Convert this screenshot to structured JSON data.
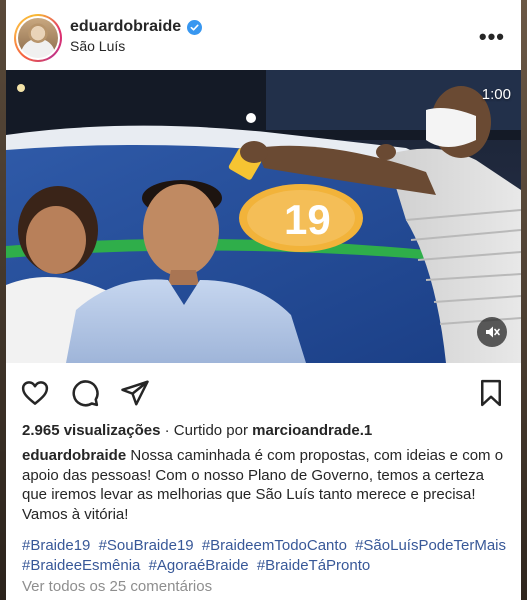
{
  "post": {
    "username": "eduardobraide",
    "location": "São Luís",
    "more_label": "•••",
    "video_time": "1:00",
    "overlay_number": "19",
    "views": "2.965 visualizações",
    "liked_by_prefix": "· Curtido por",
    "liked_by_user": "marcioandrade.1",
    "caption_author": "eduardobraide",
    "caption_text": "Nossa caminhada é com propostas, com ideias e com o apoio das pessoas! Com o nosso Plano de Governo, temos a certeza que iremos levar as melhorias que São Luís tanto merece e precisa! Vamos à vitória!",
    "hashtags": [
      "#Braide19",
      "#SouBraide19",
      "#BraideemTodoCanto",
      "#SãoLuísPodeTerMais",
      "#BraideeEsmênia",
      "#AgoraéBraide",
      "#BraideTáPronto"
    ],
    "comments_link": "Ver todos os 25 comentários"
  },
  "icons": {
    "verified": "verified-badge-icon",
    "like": "heart-icon",
    "comment": "comment-bubble-icon",
    "share": "paper-plane-icon",
    "save": "bookmark-icon",
    "mute": "speaker-muted-icon"
  },
  "colors": {
    "verified": "#3897f0",
    "hashtag": "#385898",
    "muted_text": "#8e8e8e"
  }
}
